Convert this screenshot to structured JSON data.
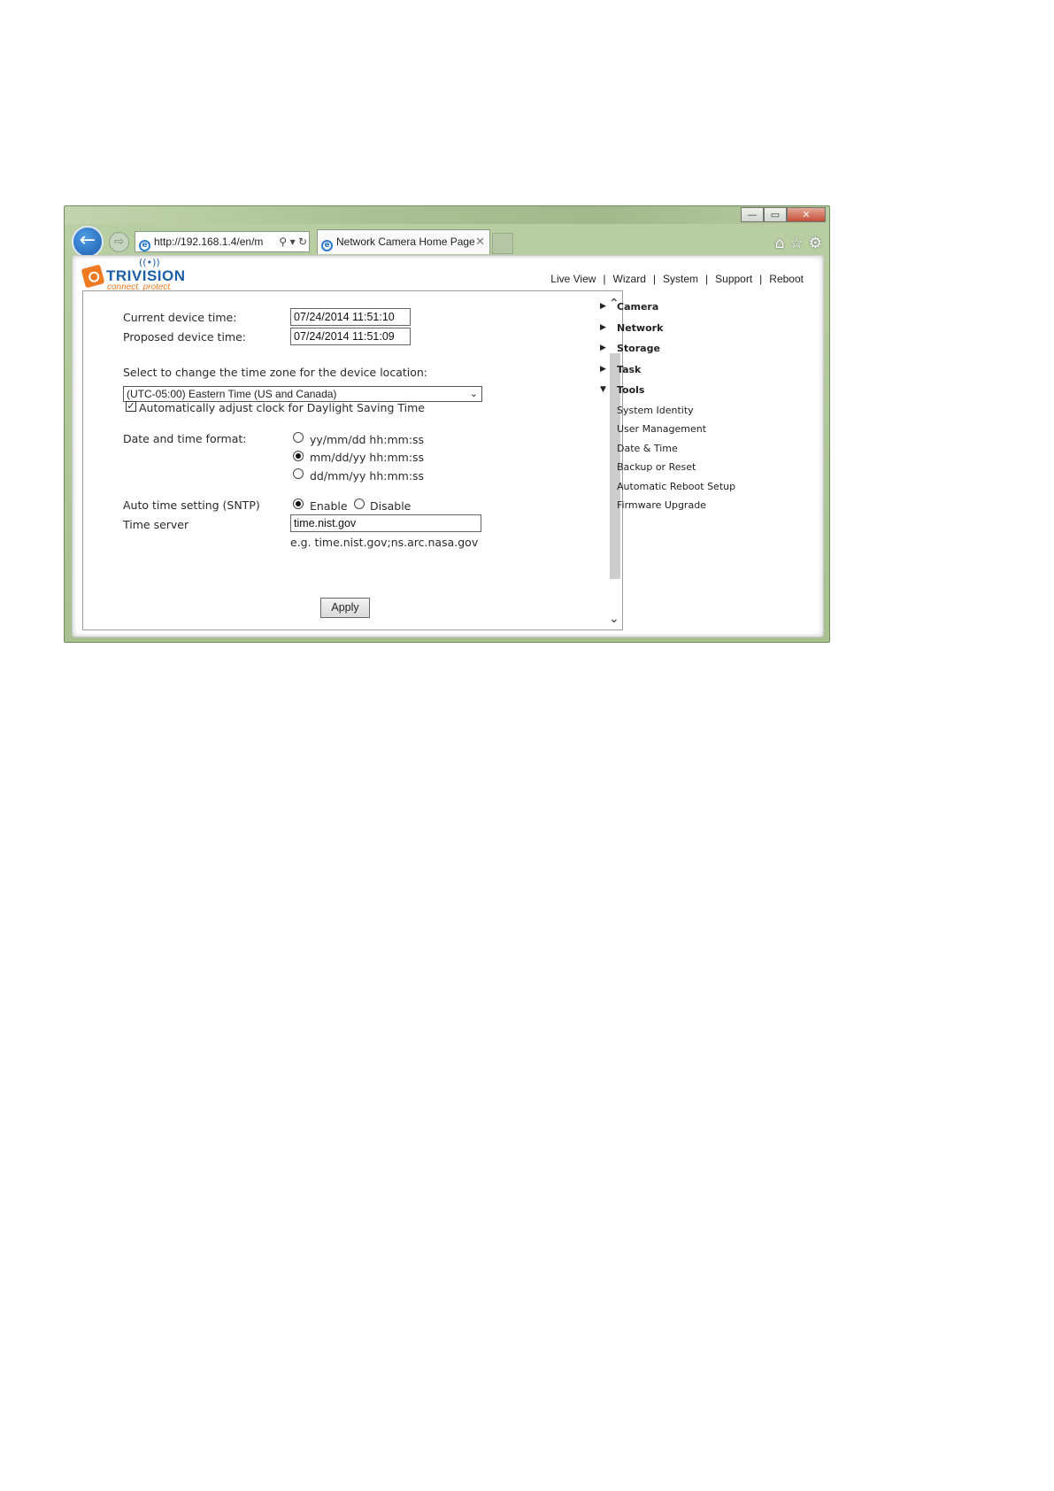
{
  "window": {
    "minimize": "—",
    "maximize": "▭",
    "close": "✕"
  },
  "browser": {
    "address": "http://192.168.1.4/en/m",
    "tab_title": "Network Camera Home Page",
    "tab_close": "✕"
  },
  "logo": {
    "name": "TRIVISION",
    "tagline": "connect. protect."
  },
  "topnav": [
    "Live View",
    "Wizard",
    "System",
    "Support",
    "Reboot"
  ],
  "form": {
    "current_label": "Current device time:",
    "current_value": "07/24/2014 11:51:10",
    "proposed_label": "Proposed device time:",
    "proposed_value": "07/24/2014 11:51:09",
    "timezone_label": "Select to change the time zone for the device location:",
    "timezone_value": "(UTC-05:00) Eastern Time (US and Canada)",
    "dst_label": "Automatically adjust clock for Daylight Saving Time",
    "dst_checked": true,
    "format_label": "Date and time format:",
    "formats": [
      "yy/mm/dd hh:mm:ss",
      "mm/dd/yy hh:mm:ss",
      "dd/mm/yy hh:mm:ss"
    ],
    "format_selected": 1,
    "sntp_label": "Auto time setting (SNTP)",
    "sntp_enable": "Enable",
    "sntp_disable": "Disable",
    "sntp_selected": "Enable",
    "server_label": "Time server",
    "server_value": "time.nist.gov",
    "server_hint": "e.g. time.nist.gov;ns.arc.nasa.gov",
    "apply": "Apply"
  },
  "sidebar": {
    "sections": [
      "Camera",
      "Network",
      "Storage",
      "Task",
      "Tools"
    ],
    "tools_items": [
      "System Identity",
      "User Management",
      "Date & Time",
      "Backup or Reset",
      "Automatic Reboot Setup",
      "Firmware Upgrade"
    ]
  }
}
